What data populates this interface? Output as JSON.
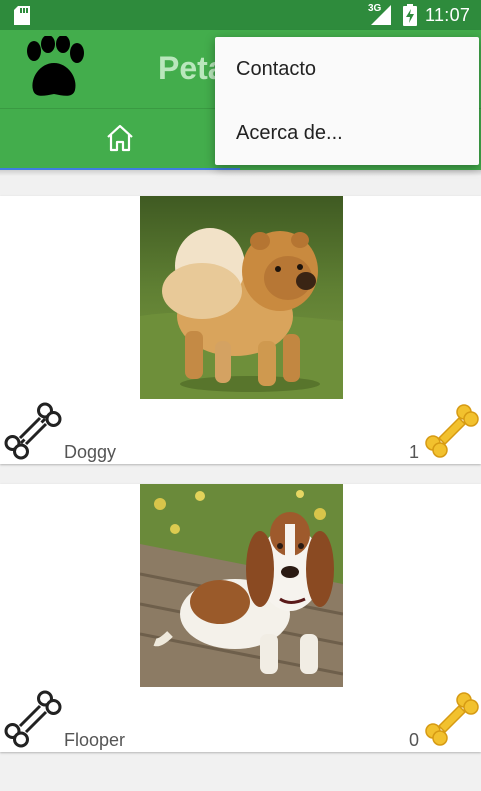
{
  "status_bar": {
    "network": "3G",
    "time": "11:07",
    "icons": [
      "sd-card-icon",
      "signal-icon",
      "battery-icon"
    ]
  },
  "toolbar": {
    "title": "Peta",
    "logo": "paw-icon",
    "color": "#43ad4c"
  },
  "tabs": {
    "home_icon": "home-icon",
    "indicator_color": "#3f7de0"
  },
  "menu": {
    "items": [
      {
        "label": "Contacto"
      },
      {
        "label": "Acerca de..."
      }
    ]
  },
  "pets": [
    {
      "name": "Doggy",
      "likes": "1",
      "photo": "chow-chow-dog-photo"
    },
    {
      "name": "Flooper",
      "likes": "0",
      "photo": "basset-hound-dog-photo"
    }
  ],
  "colors": {
    "status_bar": "#2e8b3c",
    "bone_gold": "#f2c12e"
  }
}
